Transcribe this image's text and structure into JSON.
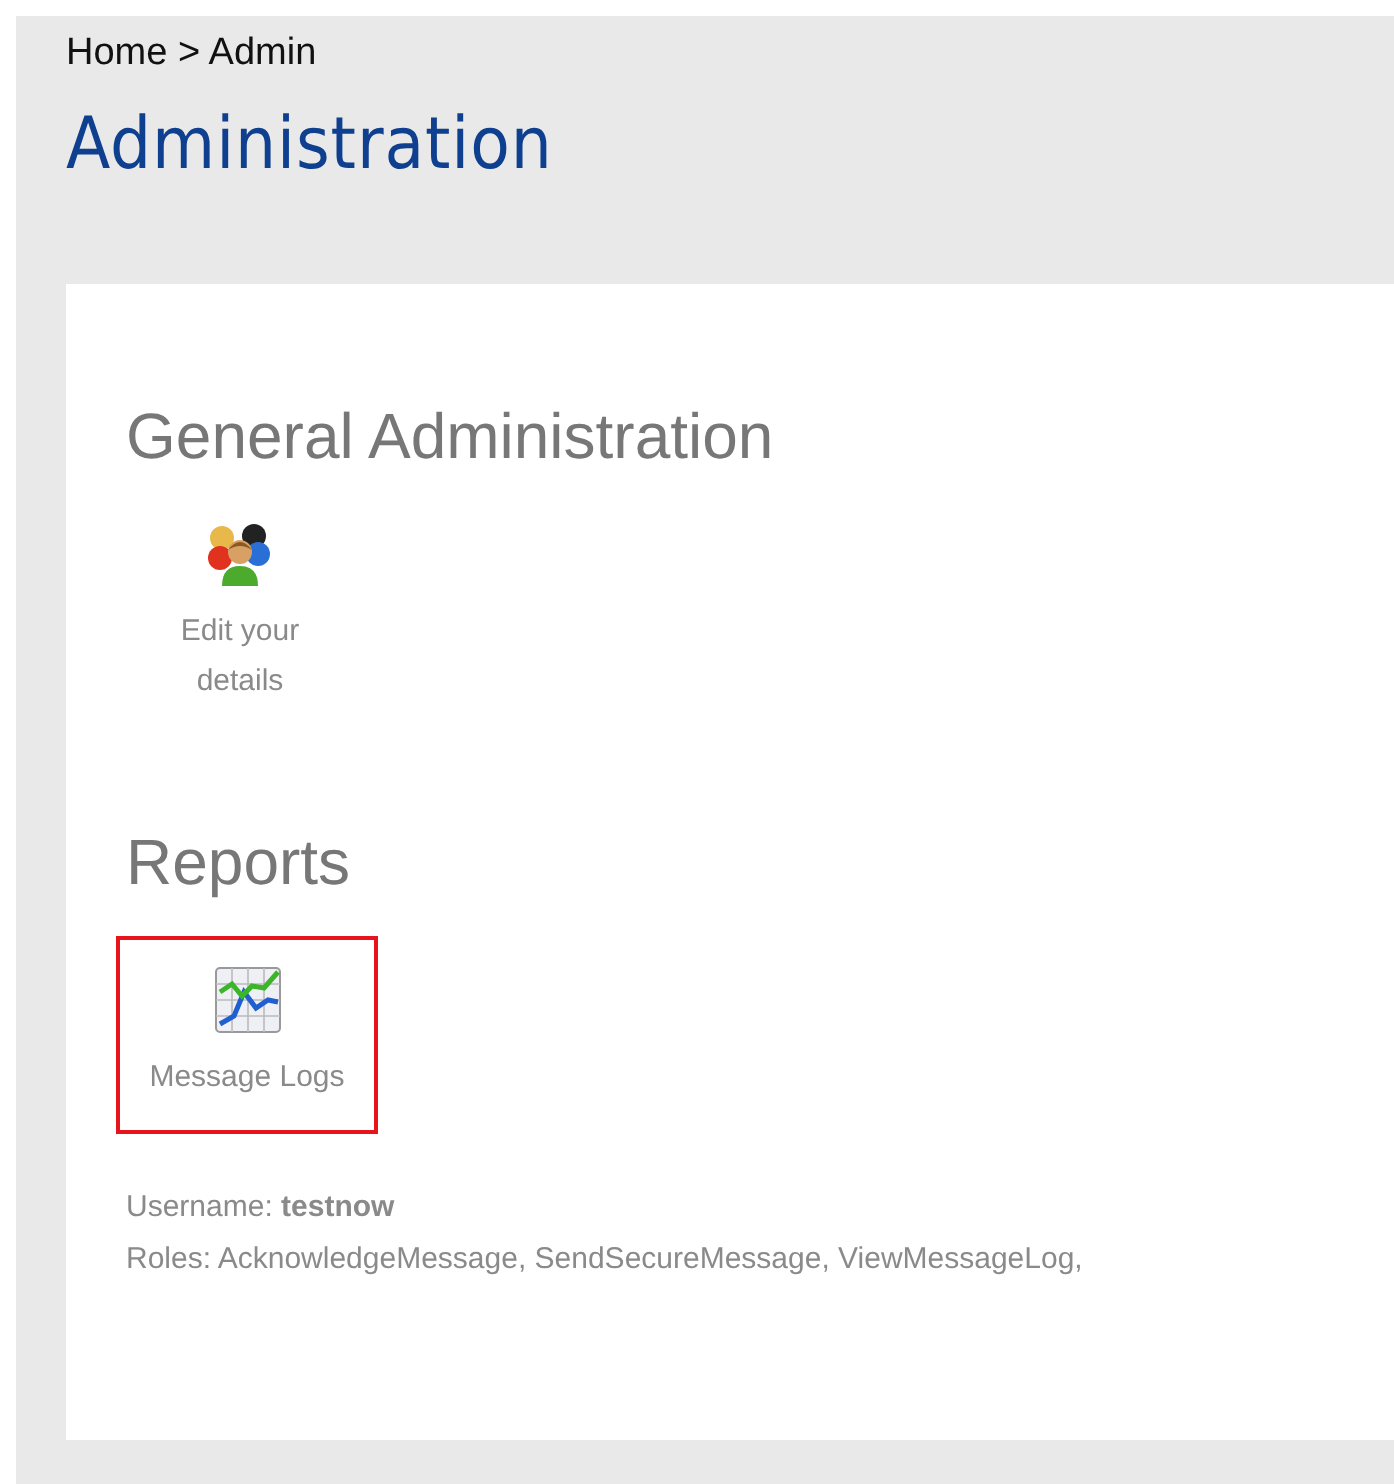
{
  "breadcrumb": "Home > Admin",
  "title": "Administration",
  "sections": [
    {
      "heading": "General Administration",
      "items": [
        {
          "label": "Edit your details",
          "kind": "people",
          "highlighted": false
        }
      ]
    },
    {
      "heading": "Reports",
      "items": [
        {
          "label": "Message Logs",
          "kind": "chart",
          "highlighted": true
        }
      ]
    }
  ],
  "user_info": [
    "Username: **testnow**",
    "Roles: AcknowledgeMessage, SendSecureMessage, ViewMessageLog,"
  ]
}
